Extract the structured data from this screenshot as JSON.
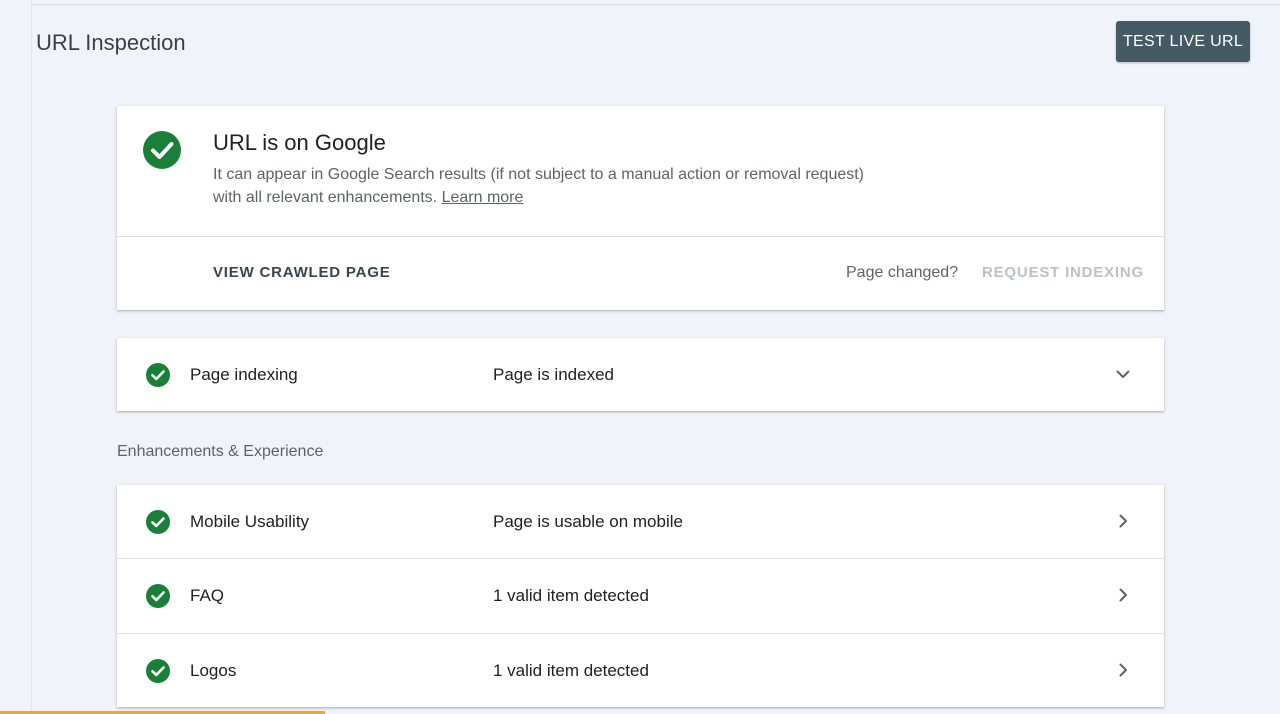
{
  "header": {
    "title": "URL Inspection",
    "test_live_url_label": "TEST LIVE URL"
  },
  "status": {
    "title": "URL is on Google",
    "description": "It can appear in Google Search results (if not subject to a manual action or removal request) with all relevant enhancements.",
    "learn_more": "Learn more",
    "view_crawled_page": "VIEW CRAWLED PAGE",
    "page_changed": "Page changed?",
    "request_indexing": "REQUEST INDEXING"
  },
  "indexing": {
    "label": "Page indexing",
    "value": "Page is indexed"
  },
  "enhancements": {
    "section_label": "Enhancements & Experience",
    "items": [
      {
        "label": "Mobile Usability",
        "value": "Page is usable on mobile"
      },
      {
        "label": "FAQ",
        "value": "1 valid item detected"
      },
      {
        "label": "Logos",
        "value": "1 valid item detected"
      }
    ]
  },
  "colors": {
    "success": "#188038",
    "primary_button": "#455a64",
    "progress": "#f5a623"
  },
  "icons": {
    "status": "check-circle-icon",
    "expand": "chevron-down-icon",
    "navigate": "chevron-right-icon"
  }
}
